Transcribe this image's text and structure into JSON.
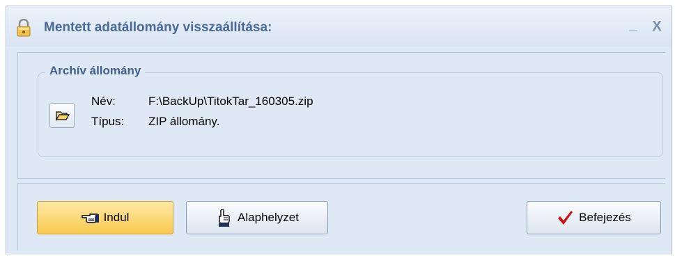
{
  "window": {
    "title": "Mentett adatállomány visszaállítása:",
    "minimize_label": "_",
    "close_label": "X",
    "title_icon": "lock-icon"
  },
  "archive": {
    "group_title": "Archív állomány",
    "name_label": "Név:",
    "name_value": "F:\\BackUp\\TitokTar_160305.zip",
    "type_label": "Típus:",
    "type_value": "ZIP állomány.",
    "open_icon": "folder-open-icon"
  },
  "buttons": {
    "start_label": "Indul",
    "start_icon": "pointing-hand-icon",
    "reset_label": "Alaphelyzet",
    "reset_icon": "thumbs-up-hand-icon",
    "finish_label": "Befejezés",
    "finish_icon": "checkmark-icon"
  },
  "colors": {
    "title_text": "#4a6b99",
    "primary_button": "#f8c94e",
    "checkmark": "#d10f0f"
  }
}
